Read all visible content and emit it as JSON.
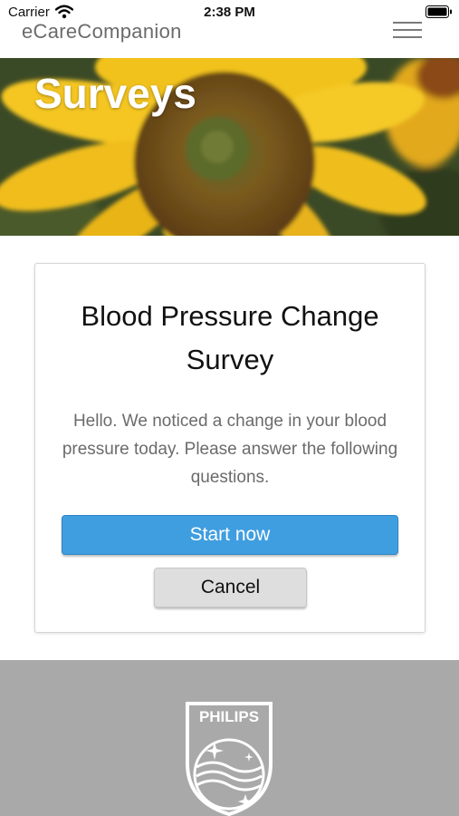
{
  "status_bar": {
    "carrier": "Carrier",
    "time": "2:38 PM",
    "icons": [
      "wifi-icon",
      "battery-icon"
    ]
  },
  "header": {
    "brand": "eCareCompanion",
    "menu_icon": "hamburger-menu-icon"
  },
  "hero": {
    "title": "Surveys",
    "image": "sunflower-banner"
  },
  "survey_card": {
    "title": "Blood Pressure Change Survey",
    "message": "Hello. We noticed a change in your blood pressure today. Please answer the following questions.",
    "start_label": "Start now",
    "cancel_label": "Cancel"
  },
  "footer": {
    "logo_text": "PHILIPS",
    "logo_icon": "philips-shield-logo"
  },
  "colors": {
    "primary_button": "#3f9ee0",
    "secondary_button": "#dedede",
    "footer_bg": "#a9a9a9",
    "brand_text": "#6b6b6b"
  }
}
